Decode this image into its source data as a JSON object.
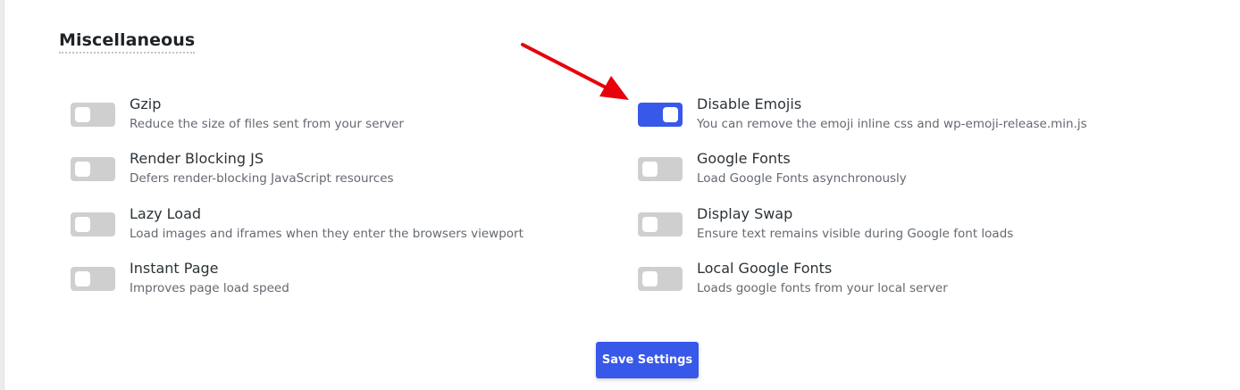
{
  "section": {
    "title": "Miscellaneous"
  },
  "colors": {
    "accent": "#3858e9",
    "toggle_off": "#cfcfcf",
    "arrow": "#e8000b"
  },
  "left_options": [
    {
      "title": "Gzip",
      "description": "Reduce the size of files sent from your server",
      "enabled": false
    },
    {
      "title": "Render Blocking JS",
      "description": "Defers render-blocking JavaScript resources",
      "enabled": false
    },
    {
      "title": "Lazy Load",
      "description": "Load images and iframes when they enter the browsers viewport",
      "enabled": false
    },
    {
      "title": "Instant Page",
      "description": "Improves page load speed",
      "enabled": false
    }
  ],
  "right_options": [
    {
      "title": "Disable Emojis",
      "description": "You can remove the emoji inline css and wp-emoji-release.min.js",
      "enabled": true
    },
    {
      "title": "Google Fonts",
      "description": "Load Google Fonts asynchronously",
      "enabled": false
    },
    {
      "title": "Display Swap",
      "description": "Ensure text remains visible during Google font loads",
      "enabled": false
    },
    {
      "title": "Local Google Fonts",
      "description": "Loads google fonts from your local server",
      "enabled": false
    }
  ],
  "annotation": {
    "icon": "red-arrow-icon",
    "points_to": "Disable Emojis"
  },
  "footer": {
    "save_label": "Save Settings"
  }
}
